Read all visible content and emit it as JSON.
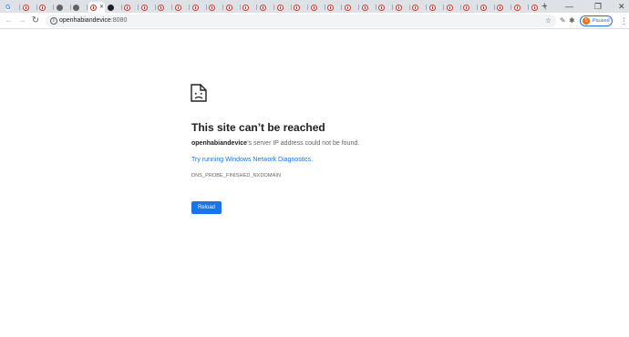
{
  "browser": {
    "tabs": [
      {
        "icon": "google-g-icon",
        "active": false
      },
      {
        "icon": "error-icon",
        "active": false
      },
      {
        "icon": "error-icon",
        "active": false
      },
      {
        "icon": "globe-icon",
        "active": false
      },
      {
        "icon": "globe-icon",
        "active": false
      },
      {
        "icon": "error-icon",
        "active": true
      },
      {
        "icon": "github-icon",
        "active": false
      },
      {
        "icon": "error-icon",
        "active": false
      },
      {
        "icon": "error-icon",
        "active": false
      },
      {
        "icon": "error-icon",
        "active": false
      },
      {
        "icon": "error-icon",
        "active": false
      },
      {
        "icon": "error-icon",
        "active": false
      },
      {
        "icon": "error-icon",
        "active": false
      },
      {
        "icon": "error-icon",
        "active": false
      },
      {
        "icon": "error-icon",
        "active": false
      },
      {
        "icon": "error-icon",
        "active": false
      },
      {
        "icon": "error-icon",
        "active": false
      },
      {
        "icon": "error-icon",
        "active": false
      },
      {
        "icon": "error-icon",
        "active": false
      },
      {
        "icon": "error-icon",
        "active": false
      },
      {
        "icon": "error-icon",
        "active": false
      },
      {
        "icon": "error-icon",
        "active": false
      },
      {
        "icon": "error-icon",
        "active": false
      },
      {
        "icon": "error-icon",
        "active": false
      },
      {
        "icon": "error-icon",
        "active": false
      },
      {
        "icon": "error-icon",
        "active": false
      },
      {
        "icon": "error-icon",
        "active": false
      },
      {
        "icon": "error-icon",
        "active": false
      },
      {
        "icon": "error-icon",
        "active": false
      },
      {
        "icon": "error-icon",
        "active": false
      },
      {
        "icon": "error-icon",
        "active": false
      },
      {
        "icon": "error-icon",
        "active": false
      }
    ],
    "new_tab_glyph": "+",
    "url_host": "openhabiandevice",
    "url_port": ":8080",
    "profile_initial": "S",
    "profile_status": "Paused",
    "accent_color": "#1a73e8"
  },
  "error_page": {
    "title": "This site can’t be reached",
    "host": "openhabiandevice",
    "message_rest": "’s server IP address could not be found.",
    "diagnostics_link": "Try running Windows Network Diagnostics.",
    "error_code": "DNS_PROBE_FINISHED_NXDOMAIN",
    "reload_label": "Reload"
  }
}
